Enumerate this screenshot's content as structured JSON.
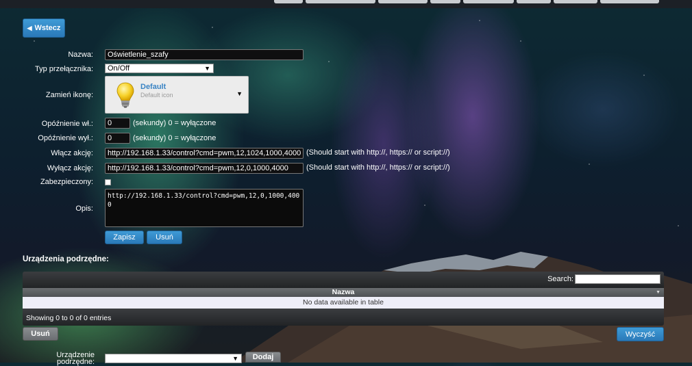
{
  "back_button": {
    "label": "Wstecz"
  },
  "form": {
    "name": {
      "label": "Nazwa:",
      "value": "Oświetlenie_szafy"
    },
    "switch_type": {
      "label": "Typ przełącznika:",
      "value": "On/Off"
    },
    "icon": {
      "label": "Zamień ikonę:",
      "title": "Default",
      "subtitle": "Default icon"
    },
    "on_delay": {
      "label": "Opóźnienie wł.:",
      "value": "0",
      "hint": "(sekundy) 0 = wyłączone"
    },
    "off_delay": {
      "label": "Opóźnienie wył.:",
      "value": "0",
      "hint": "(sekundy) 0 = wyłączone"
    },
    "on_action": {
      "label": "Włącz akcję:",
      "value": "http://192.168.1.33/control?cmd=pwm,12,1024,1000,4000",
      "hint": "(Should start with http://, https:// or script://)"
    },
    "off_action": {
      "label": "Wyłącz akcję:",
      "value": "http://192.168.1.33/control?cmd=pwm,12,0,1000,4000",
      "hint": "(Should start with http://, https:// or script://)"
    },
    "protected": {
      "label": "Zabezpieczony:",
      "checked": false
    },
    "description": {
      "label": "Opis:",
      "value": "http://192.168.1.33/control?cmd=pwm,12,0,1000,4000"
    },
    "save_label": "Zapisz",
    "cancel_label": "Usuń"
  },
  "subdevices": {
    "title": "Urządzenia podrzędne:",
    "search_label": "Search:",
    "columns": [
      "Nazwa"
    ],
    "empty_text": "No data available in table",
    "info_text": "Showing 0 to 0 of 0 entries",
    "delete_label": "Usuń",
    "clear_label": "Wyczyść",
    "add_device_label": "Urządzenie podrzędne:",
    "add_label": "Dodaj"
  },
  "colors": {
    "accent": "#2f86c6",
    "grey_button": "#76797c"
  }
}
